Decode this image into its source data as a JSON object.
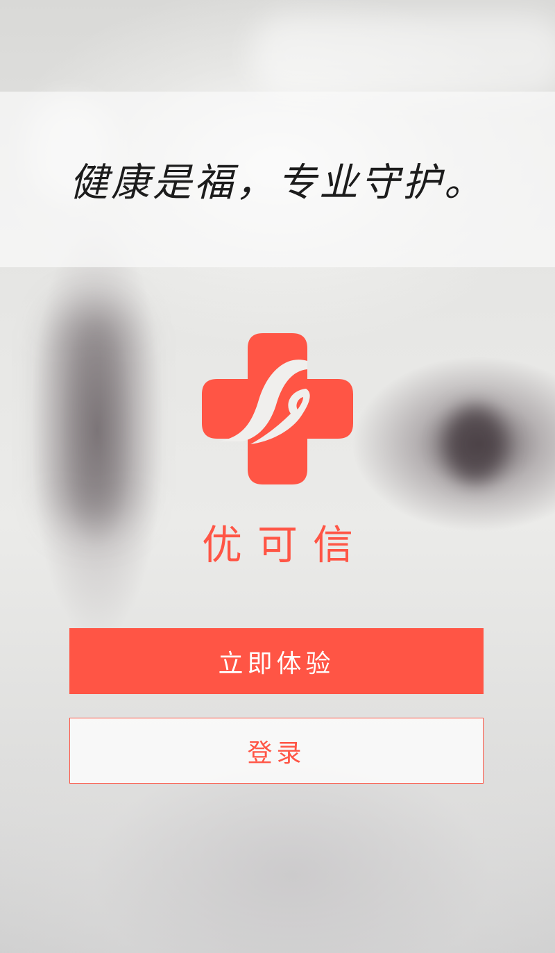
{
  "app": {
    "name": "优可信",
    "slogan": "健康是福，专业守护。"
  },
  "actions": {
    "try_now_label": "立即体验",
    "login_label": "登录"
  },
  "icons": {
    "logo": "medical-cross-hand-logo"
  },
  "colors": {
    "accent": "#ff5545",
    "button_text": "#ffffff",
    "slogan_text": "#1c1c1c"
  }
}
